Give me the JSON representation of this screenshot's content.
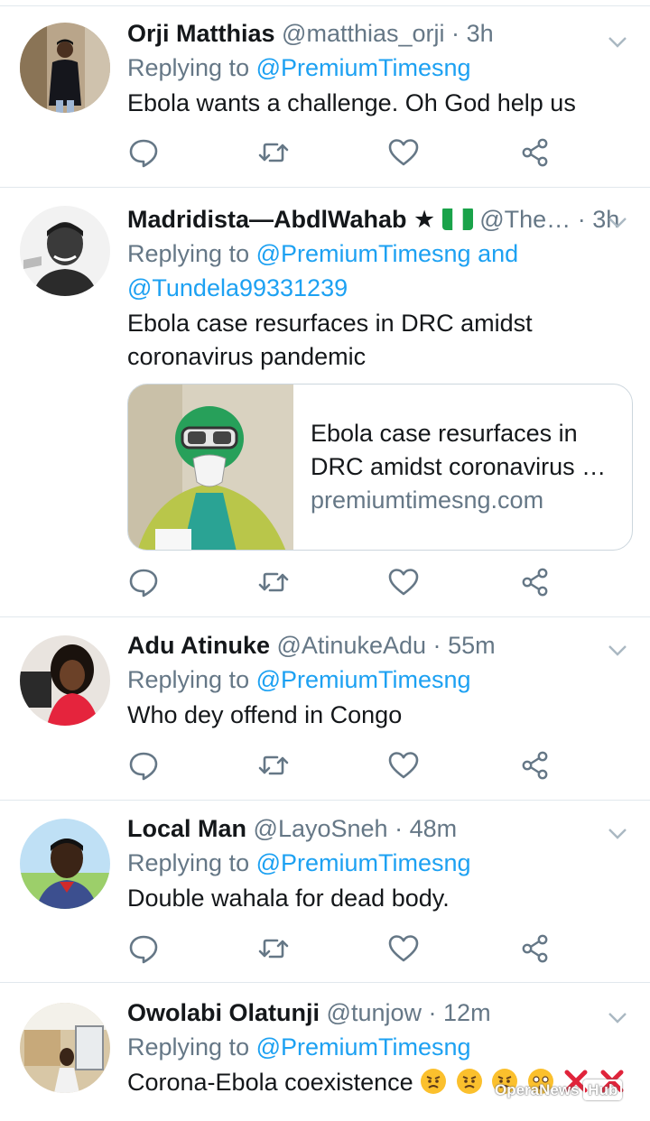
{
  "tweets": [
    {
      "name": "Orji Matthias",
      "handle": "@matthias_orji",
      "sep": "·",
      "time": "3h",
      "replying_prefix": "Replying to",
      "mentions": [
        "@PremiumTimesng"
      ],
      "text": "Ebola wants a challenge. Oh God help us"
    },
    {
      "name": "Madridista—AbdlWahab ★",
      "handle": "@The…",
      "sep": "·",
      "time": "3h",
      "replying_prefix": "Replying to",
      "mentions": [
        "@PremiumTimesng",
        "@Tundela99331239"
      ],
      "mention_joiner": "and",
      "text_lines": [
        "Ebola case resurfaces in DRC amidst",
        "coronavirus pandemic"
      ],
      "card": {
        "title_line1": "Ebola case resurfaces in",
        "title_line2": "DRC amidst coronavirus p…",
        "domain": "premiumtimesng.com"
      }
    },
    {
      "name": "Adu Atinuke",
      "handle": "@AtinukeAdu",
      "sep": "·",
      "time": "55m",
      "replying_prefix": "Replying to",
      "mentions": [
        "@PremiumTimesng"
      ],
      "text": "Who dey offend in Congo"
    },
    {
      "name": "Local Man",
      "handle": "@LayoSneh",
      "sep": "·",
      "time": "48m",
      "replying_prefix": "Replying to",
      "mentions": [
        "@PremiumTimesng"
      ],
      "text": "Double wahala for dead body."
    },
    {
      "name": "Owolabi Olatunji",
      "handle": "@tunjow",
      "sep": "·",
      "time": "12m",
      "replying_prefix": "Replying to",
      "mentions": [
        "@PremiumTimesng"
      ],
      "text": "Corona-Ebola coexistence"
    }
  ],
  "icons": {
    "reply": "reply-icon",
    "retweet": "retweet-icon",
    "like": "heart-icon",
    "share": "share-icon",
    "menu": "chevron-down-icon"
  },
  "watermark": {
    "brand": "OperaNews",
    "badge": "Hub"
  },
  "colors": {
    "link": "#1da1f2",
    "secondary": "#657786",
    "text": "#14171a",
    "divider": "#e1e8ed"
  }
}
